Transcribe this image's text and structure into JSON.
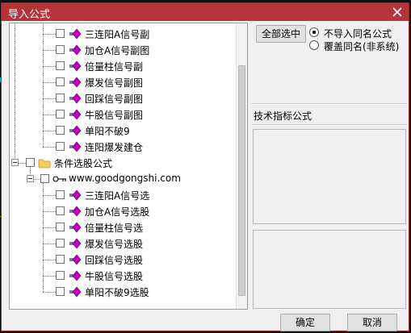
{
  "dialog": {
    "title": "导入公式",
    "colors": {
      "titlebar": "#b5343a",
      "formula_icon": "#c000c0"
    }
  },
  "tree": {
    "items": [
      {
        "label": "三连阳A信号副",
        "type": "formula"
      },
      {
        "label": "加仓A信号副图",
        "type": "formula"
      },
      {
        "label": "倍量柱信号副",
        "type": "formula"
      },
      {
        "label": "爆发信号副图",
        "type": "formula"
      },
      {
        "label": "回踩信号副图",
        "type": "formula"
      },
      {
        "label": "牛股信号副图",
        "type": "formula"
      },
      {
        "label": "单阳不破9",
        "type": "formula"
      },
      {
        "label": "连阳爆发建仓",
        "type": "formula"
      },
      {
        "label": "条件选股公式",
        "type": "folder"
      },
      {
        "label": "www.goodgongshi.com",
        "type": "key"
      },
      {
        "label": "三连阳A信号选",
        "type": "formula"
      },
      {
        "label": "加仓A信号选股",
        "type": "formula"
      },
      {
        "label": "倍量柱信号选",
        "type": "formula"
      },
      {
        "label": "爆发信号选股",
        "type": "formula"
      },
      {
        "label": "回踩信号选股",
        "type": "formula"
      },
      {
        "label": "牛股信号选股",
        "type": "formula"
      },
      {
        "label": "单阳不破9选股",
        "type": "formula"
      }
    ]
  },
  "options": {
    "select_all_label": "全部选中",
    "radio_no_import": "不导入同名公式",
    "radio_overwrite": "覆盖同名(非系统)",
    "selected": "no_import"
  },
  "formula_section_label": "技术指标公式",
  "footer": {
    "ok_label": "确定",
    "cancel_label": "取消"
  },
  "icons": [
    "close-icon",
    "folder-icon",
    "key-icon",
    "formula-icon",
    "expander-minus-icon"
  ]
}
